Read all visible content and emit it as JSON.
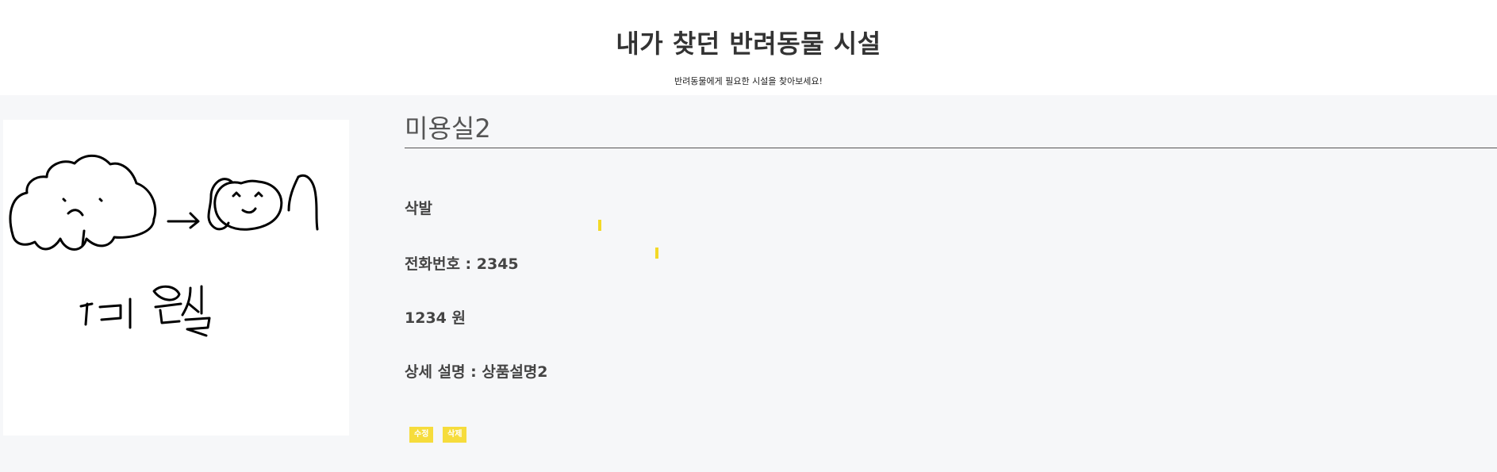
{
  "header": {
    "title": "내가 찾던 반려동물 시설",
    "subtitle": "반려동물에게 필요한 시설을 찾아보세요!"
  },
  "facility": {
    "image_alt": "미용실",
    "name": "미용실2",
    "service": "삭발",
    "phone": "전화번호 : 2345",
    "price": "1234 원",
    "description": "상세 설명 : 상품설명2"
  },
  "actions": {
    "edit_label": "수정",
    "delete_label": "삭제"
  },
  "colors": {
    "button": "#f6dc3c",
    "main_background": "#f6f7f9"
  }
}
